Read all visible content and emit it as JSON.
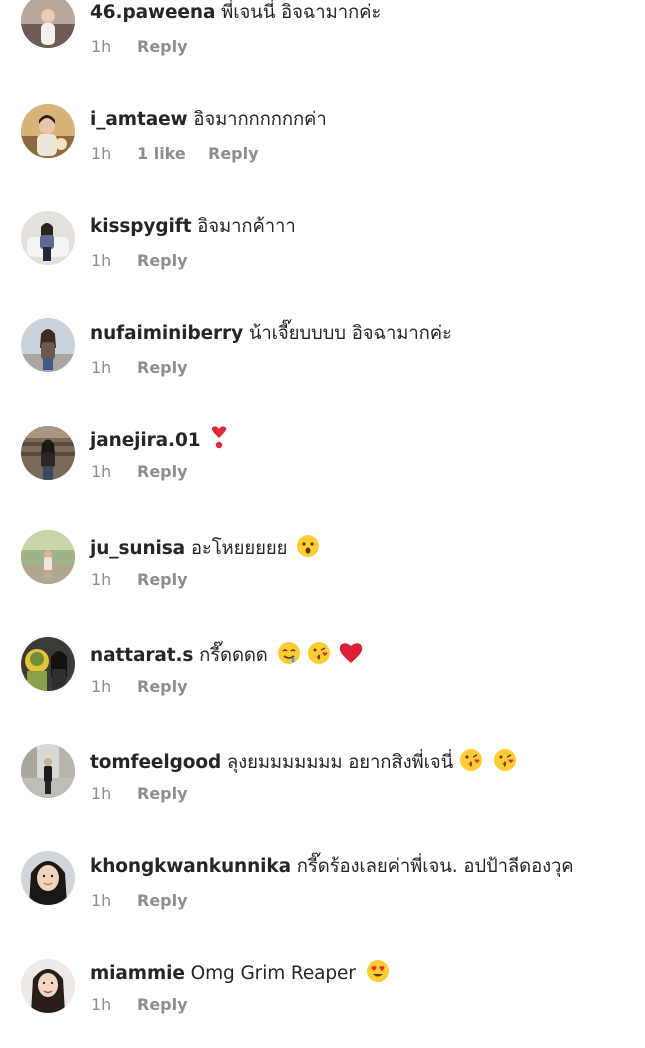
{
  "comments": [
    {
      "username": "46.paweena",
      "text": "พี่เจนนี่ อิจฉามากค่ะ",
      "time": "1h",
      "likes": "",
      "reply": "Reply",
      "emojis": []
    },
    {
      "username": "i_amtaew",
      "text": "อิจมากกกกกกค่า",
      "time": "1h",
      "likes": "1 like",
      "reply": "Reply",
      "emojis": []
    },
    {
      "username": "kisspygift",
      "text": "อิจมากค้าาา",
      "time": "1h",
      "likes": "",
      "reply": "Reply",
      "emojis": []
    },
    {
      "username": "nufaiminiberry",
      "text": "น้าเจี๊ยบบบบ อิจฉามากค่ะ",
      "time": "1h",
      "likes": "",
      "reply": "Reply",
      "emojis": []
    },
    {
      "username": "janejira.01",
      "text": "",
      "time": "1h",
      "likes": "",
      "reply": "Reply",
      "emojis": [
        "heavy-exclamation-heart-icon"
      ]
    },
    {
      "username": "ju_sunisa",
      "text": "อะโหยยยยย",
      "time": "1h",
      "likes": "",
      "reply": "Reply",
      "emojis": [
        "hushed-face-icon"
      ]
    },
    {
      "username": "nattarat.s",
      "text": "กรี๊ดดดด",
      "time": "1h",
      "likes": "",
      "reply": "Reply",
      "emojis": [
        "drooling-face-icon",
        "kissing-heart-face-icon",
        "red-heart-icon"
      ]
    },
    {
      "username": "tomfeelgood",
      "text": "ลุงยมมมมมมม อยากสิงพี่เจนี่",
      "time": "1h",
      "likes": "",
      "reply": "Reply",
      "emojis": [
        "kissing-heart-face-icon",
        "kissing-heart-face-icon"
      ]
    },
    {
      "username": "khongkwankunnika",
      "text": "กรี๊ดร้องเลยค่าพี่เจน. อปป้าลีดองวุค",
      "time": "1h",
      "likes": "",
      "reply": "Reply",
      "emojis": []
    },
    {
      "username": "miammie",
      "text": "Omg Grim Reaper",
      "time": "1h",
      "likes": "",
      "reply": "Reply",
      "emojis": [
        "heart-eyes-face-icon"
      ]
    }
  ]
}
